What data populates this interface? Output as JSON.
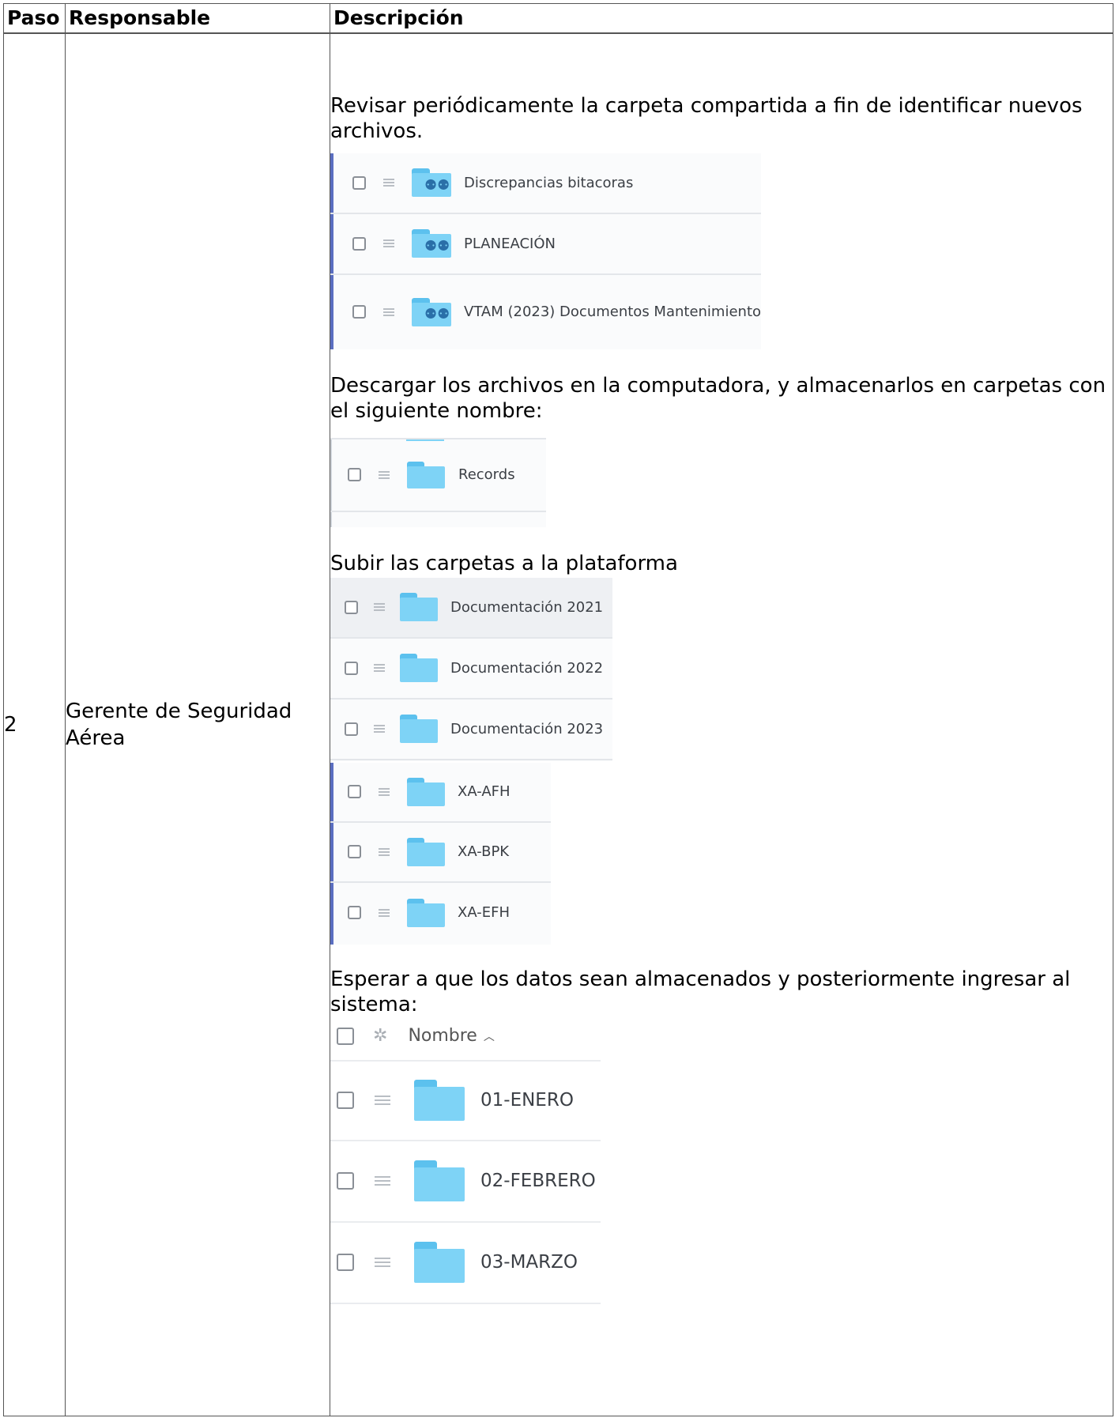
{
  "table": {
    "headers": {
      "paso": "Paso",
      "responsable": "Responsable",
      "descripcion": "Descripción"
    },
    "row": {
      "paso": "2",
      "responsable": "Gerente de Seguridad Aérea",
      "paragraphs": [
        "Revisar periódicamente la carpeta compartida a fin de identificar nuevos archivos.",
        "Descargar los archivos en la computadora, y almacenarlos en carpetas con el siguiente nombre:",
        "Subir las carpetas a la plataforma",
        "Esperar a que los datos sean almacenados y posteriormente ingresar al sistema:"
      ]
    }
  },
  "shared_folders": [
    "Discrepancias bitacoras",
    "PLANEACIÓN",
    "VTAM (2023) Documentos Mantenimiento"
  ],
  "records_folder": [
    "Records"
  ],
  "documentation_folders": [
    "Documentación 2021",
    "Documentación 2022",
    "Documentación 2023"
  ],
  "aircraft_folders": [
    "XA-AFH",
    "XA-BPK",
    "XA-EFH"
  ],
  "system_list": {
    "header": "Nombre",
    "sort_indicator": "^",
    "folders": [
      "01-ENERO",
      "02-FEBRERO",
      "03-MARZO"
    ]
  },
  "colors": {
    "folder": "#7ed3f6",
    "folder_tab": "#5cc1ee",
    "selection_bar": "#5a6ec0"
  },
  "icons": {
    "checkbox": "checkbox-icon",
    "drag_handle": "drag-handle-icon",
    "folder": "folder-icon",
    "shared_folder": "shared-folder-icon",
    "settings": "gear-icon",
    "sort": "chevron-up-icon"
  }
}
